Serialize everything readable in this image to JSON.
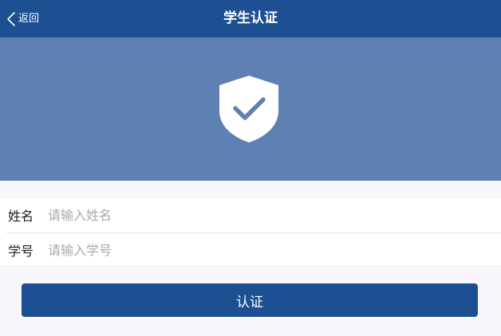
{
  "colors": {
    "header_bg": "#1d4f93",
    "banner_bg": "#5f80b2",
    "page_bg": "#f9f7fd",
    "button_bg": "#1d4f93"
  },
  "header": {
    "back_label": "返回",
    "back_icon": "chevron-left-icon",
    "title": "学生认证"
  },
  "banner": {
    "icon": "shield-check-icon"
  },
  "form": {
    "name_label": "姓名",
    "name_placeholder": "请输入姓名",
    "name_value": "",
    "student_id_label": "学号",
    "student_id_placeholder": "请输入学号",
    "student_id_value": ""
  },
  "submit_label": "认证"
}
